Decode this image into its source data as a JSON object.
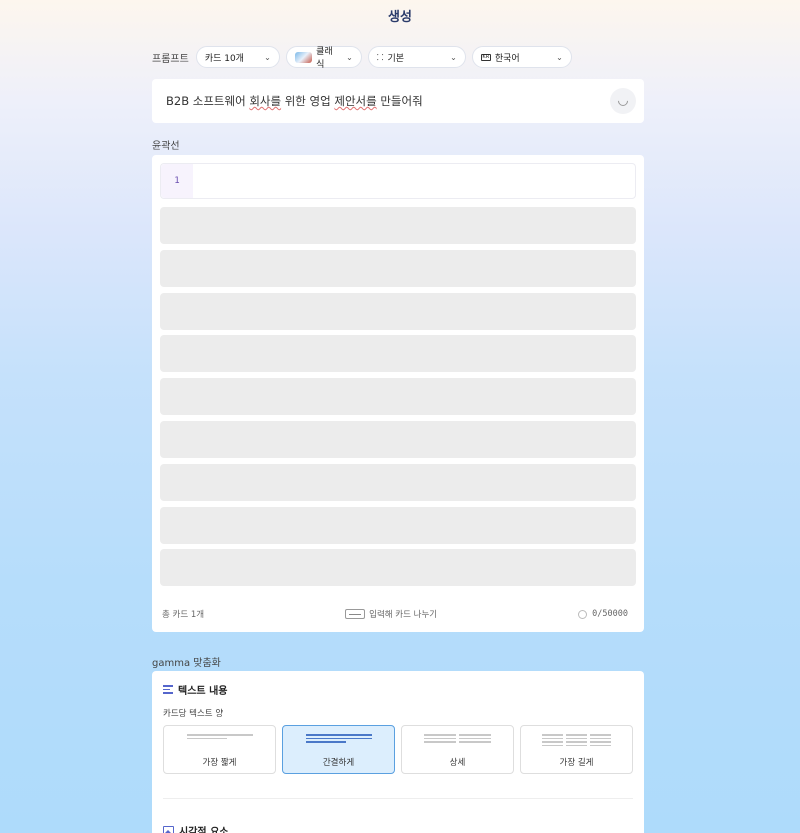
{
  "header": {
    "title": "생성"
  },
  "toolbar": {
    "label": "프롬프트",
    "cards": "카드 10개",
    "theme": "클래식",
    "size_icon": "⸬",
    "size": "기본",
    "lang_icon": "KR",
    "language": "한국어"
  },
  "prompt": {
    "part1": "B2B 소프트웨어 ",
    "sq1": "회사를",
    "part2": " 위한 영업 ",
    "sq2": "제안서를",
    "part3": " 만들어줘"
  },
  "outline": {
    "label": "윤곽선",
    "first_number": "1",
    "skeleton_rows": 9,
    "total_cards": "총 카드 1개",
    "split_hint": "입력해 카드 나누기",
    "char_count": "0/50000"
  },
  "customize": {
    "label": "gamma 맞춤화",
    "text_heading": "텍스트 내용",
    "text_amount_label": "카드당 텍스트 양",
    "options": [
      {
        "label": "가장 짧게",
        "selected": false
      },
      {
        "label": "간결하게",
        "selected": true
      },
      {
        "label": "상세",
        "selected": false
      },
      {
        "label": "가장 길게",
        "selected": false
      }
    ],
    "visual_heading": "시각적 요소"
  },
  "colors": {
    "accent": "#5566cc",
    "selected_bg": "#dceefd",
    "selected_border": "#5aa0e0"
  }
}
